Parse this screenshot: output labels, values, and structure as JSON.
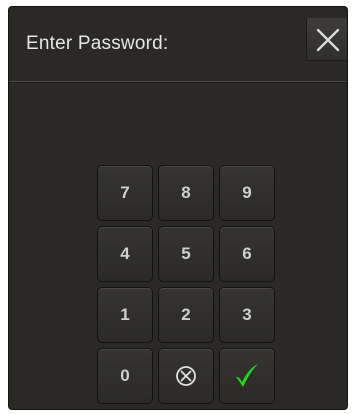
{
  "dialog": {
    "title": "Enter Password:",
    "close_icon": "close-icon"
  },
  "keypad": {
    "rows": [
      [
        "7",
        "8",
        "9"
      ],
      [
        "4",
        "5",
        "6"
      ],
      [
        "1",
        "2",
        "3"
      ]
    ],
    "zero": "0",
    "clear_icon": "circled-x-icon",
    "confirm_icon": "checkmark-icon"
  },
  "colors": {
    "background": "#2a2926",
    "text": "#e6e6e6",
    "confirm": "#27d41f"
  }
}
